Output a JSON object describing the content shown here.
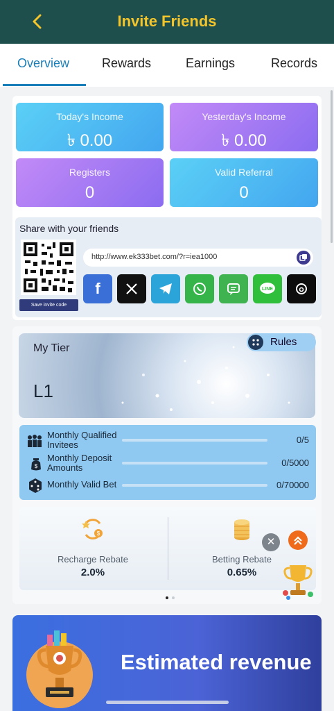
{
  "header": {
    "title": "Invite Friends"
  },
  "tabs": [
    {
      "label": "Overview",
      "active": true
    },
    {
      "label": "Rewards",
      "active": false
    },
    {
      "label": "Earnings",
      "active": false
    },
    {
      "label": "Records",
      "active": false
    }
  ],
  "stats": {
    "today": {
      "label": "Today's Income",
      "value": "৳ 0.00"
    },
    "yesterday": {
      "label": "Yesterday's Income",
      "value": "৳ 0.00"
    },
    "registers": {
      "label": "Registers",
      "value": "0"
    },
    "valid_referral": {
      "label": "Valid Referral",
      "value": "0"
    }
  },
  "share": {
    "title": "Share with your friends",
    "link": "http://www.ek333bet.com/?r=iea1000",
    "save_button": "Save invite code",
    "social": [
      "facebook",
      "x",
      "telegram",
      "whatsapp",
      "sms",
      "line",
      "threads"
    ]
  },
  "tier": {
    "title": "My Tier",
    "level": "L1",
    "rules_label": "Rules",
    "progress": [
      {
        "label_line1": "Monthly Qualified",
        "label_line2": "Invitees",
        "value": "0/5",
        "fraction": 0
      },
      {
        "label_line1": "Monthly Deposit",
        "label_line2": "Amounts",
        "value": "0/5000",
        "fraction": 0
      },
      {
        "label_line1": "Monthly Valid Bet",
        "label_line2": "",
        "value": "0/70000",
        "fraction": 0
      }
    ],
    "rebates": [
      {
        "label": "Recharge Rebate",
        "value": "2.0%"
      },
      {
        "label": "Betting Rebate",
        "value": "0.65%"
      }
    ]
  },
  "banner": {
    "text": "Estimated revenue"
  },
  "colors": {
    "header_bg": "#1f4f4d",
    "title": "#f3c52b",
    "accent": "#1a7fb8"
  }
}
